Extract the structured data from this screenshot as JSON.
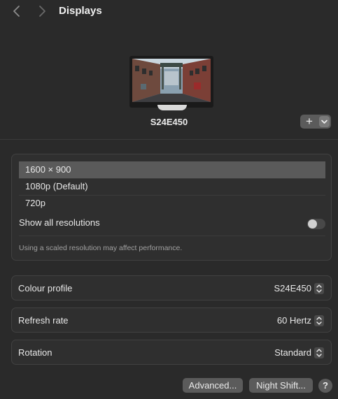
{
  "window": {
    "title": "Displays"
  },
  "display": {
    "name": "S24E450",
    "add_symbol": "+"
  },
  "resolutions": {
    "options": [
      {
        "label": "1600 × 900",
        "selected": true
      },
      {
        "label": "1080p (Default)",
        "selected": false
      },
      {
        "label": "720p",
        "selected": false
      }
    ],
    "show_all_label": "Show all resolutions",
    "show_all_enabled": false,
    "note": "Using a scaled resolution may affect performance."
  },
  "settings": {
    "colour_profile": {
      "label": "Colour profile",
      "value": "S24E450"
    },
    "refresh_rate": {
      "label": "Refresh rate",
      "value": "60 Hertz"
    },
    "rotation": {
      "label": "Rotation",
      "value": "Standard"
    }
  },
  "footer": {
    "advanced_label": "Advanced...",
    "night_shift_label": "Night Shift...",
    "help_label": "?"
  },
  "colors": {
    "background": "#2a2a2a",
    "panel": "#2f2f2f",
    "selected_row": "#5a5a5a",
    "button": "#5b5b5b"
  }
}
